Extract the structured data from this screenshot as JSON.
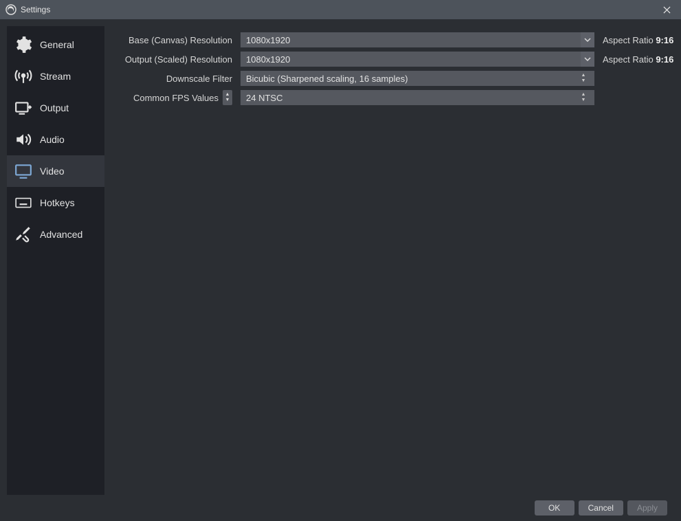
{
  "window": {
    "title": "Settings"
  },
  "sidebar": {
    "items": [
      {
        "key": "general",
        "label": "General"
      },
      {
        "key": "stream",
        "label": "Stream"
      },
      {
        "key": "output",
        "label": "Output"
      },
      {
        "key": "audio",
        "label": "Audio"
      },
      {
        "key": "video",
        "label": "Video"
      },
      {
        "key": "hotkeys",
        "label": "Hotkeys"
      },
      {
        "key": "advanced",
        "label": "Advanced"
      }
    ],
    "selected": "video"
  },
  "video": {
    "base_label": "Base (Canvas) Resolution",
    "base_value": "1080x1920",
    "base_aspect_label": "Aspect Ratio",
    "base_aspect_ratio": "9:16",
    "output_label": "Output (Scaled) Resolution",
    "output_value": "1080x1920",
    "output_aspect_label": "Aspect Ratio",
    "output_aspect_ratio": "9:16",
    "downscale_label": "Downscale Filter",
    "downscale_value": "Bicubic (Sharpened scaling, 16 samples)",
    "fps_type_label": "Common FPS Values",
    "fps_value": "24 NTSC"
  },
  "footer": {
    "ok": "OK",
    "cancel": "Cancel",
    "apply": "Apply"
  }
}
